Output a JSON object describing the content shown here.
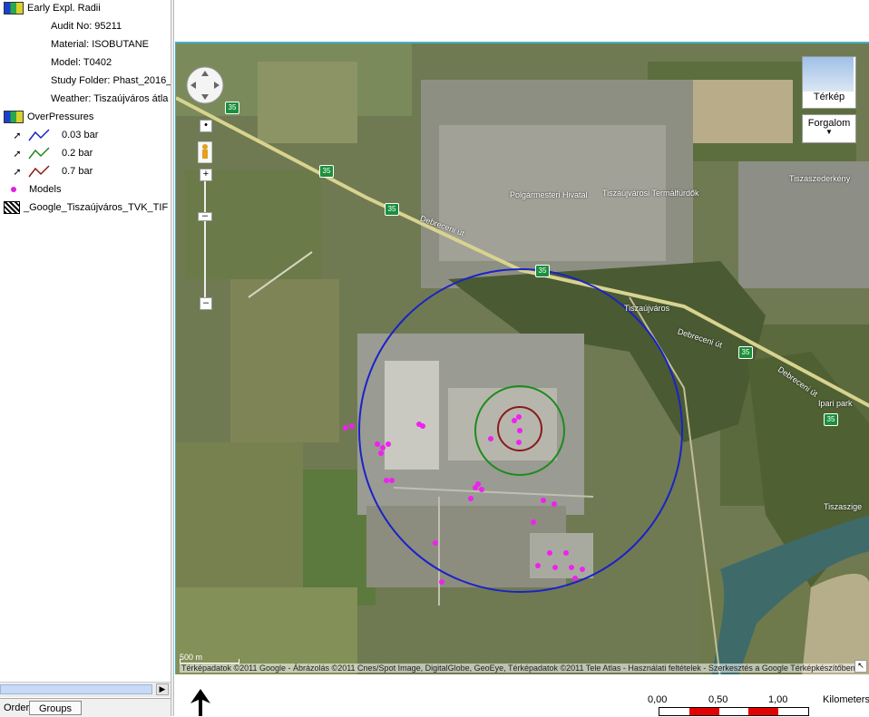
{
  "legend": {
    "layer1": {
      "title": "Early Expl. Radii"
    },
    "info": [
      "Audit No: 95211",
      "Material: ISOBUTANE",
      "Model: T0402",
      "Study Folder: Phast_2016_",
      "Weather: Tiszaújváros átla"
    ],
    "layer2": {
      "title": "OverPressures"
    },
    "pressures": [
      {
        "label": "0.03 bar",
        "color": "#1a22c8"
      },
      {
        "label": "0.2 bar",
        "color": "#1f8a1f"
      },
      {
        "label": "0.7 bar",
        "color": "#8a1a1a"
      }
    ],
    "models_label": "Models",
    "raster_label": "_Google_Tiszaújváros_TVK_TIF"
  },
  "tabs": {
    "order": "Order",
    "groups": "Groups"
  },
  "map": {
    "map_type_button": "Térkép",
    "traffic_button": "Forgalom",
    "scale_label": "500 m",
    "copyright": "Térképadatok ©2011 Google - Ábrázolás ©2011 Cnes/Spot Image, DigitalGlobe, GeoEye, Térképadatok ©2011 Tele Atlas - Használati feltételek - Szerkesztés a Google Térképkészítőben",
    "place_labels": [
      "Polgármesteri Hivatal",
      "Tiszaújvárosi Termálfürdők",
      "Tiszaszederkény",
      "Tiszaújváros",
      "Debreceni út",
      "Debreceni út",
      "Debreceni út",
      "Ipari park",
      "Tiszaszige"
    ],
    "road_number": "35"
  },
  "scalebar": {
    "ticks": [
      "0,00",
      "0,50",
      "1,00"
    ],
    "unit": "Kilometers"
  }
}
